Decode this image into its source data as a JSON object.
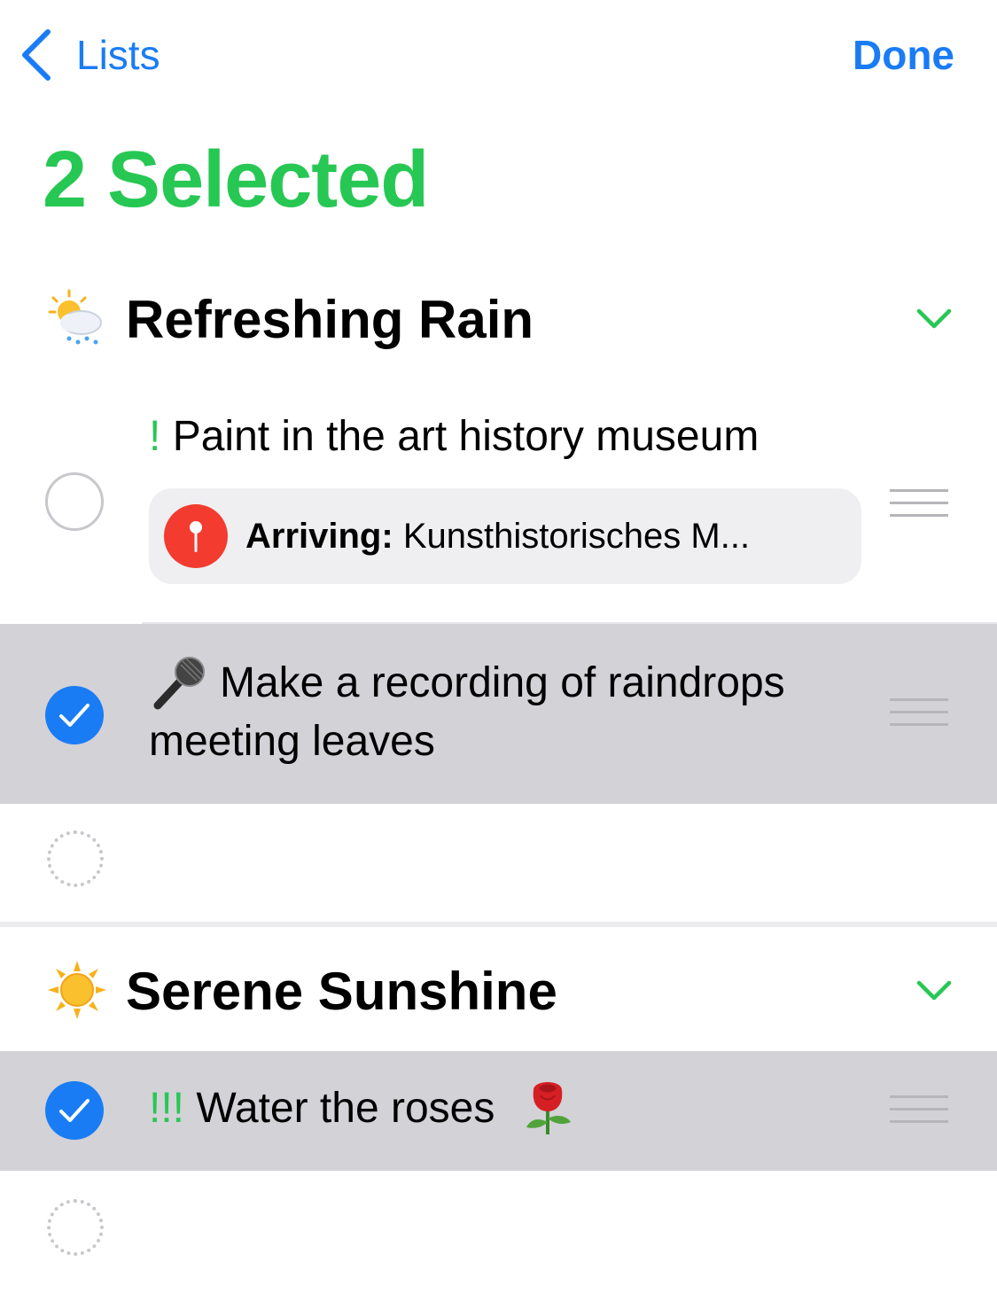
{
  "nav": {
    "back_label": "Lists",
    "done_label": "Done"
  },
  "title": "2 Selected",
  "colors": {
    "accent_blue": "#1a7cf5",
    "accent_green": "#27c754",
    "selected_row": "#d2d2d7",
    "location_pin": "#f33b30"
  },
  "sections": [
    {
      "emoji": "🌦",
      "icon": "sun-behind-rain-cloud-icon",
      "title": "Refreshing Rain",
      "items": [
        {
          "priority": "!",
          "text": "Paint in the art history museum",
          "selected": false,
          "location": {
            "label": "Arriving:",
            "place": "Kunsthistorisches M..."
          }
        },
        {
          "emoji": "🎤",
          "text_line1": "Make a recording of raindrops",
          "text_line2": "meeting leaves",
          "selected": true
        }
      ]
    },
    {
      "emoji": "☀️",
      "icon": "sun-icon",
      "title": "Serene Sunshine",
      "items": [
        {
          "priority": "!!!",
          "text": "Water the roses",
          "emoji": "🌹",
          "selected": true
        }
      ]
    }
  ]
}
